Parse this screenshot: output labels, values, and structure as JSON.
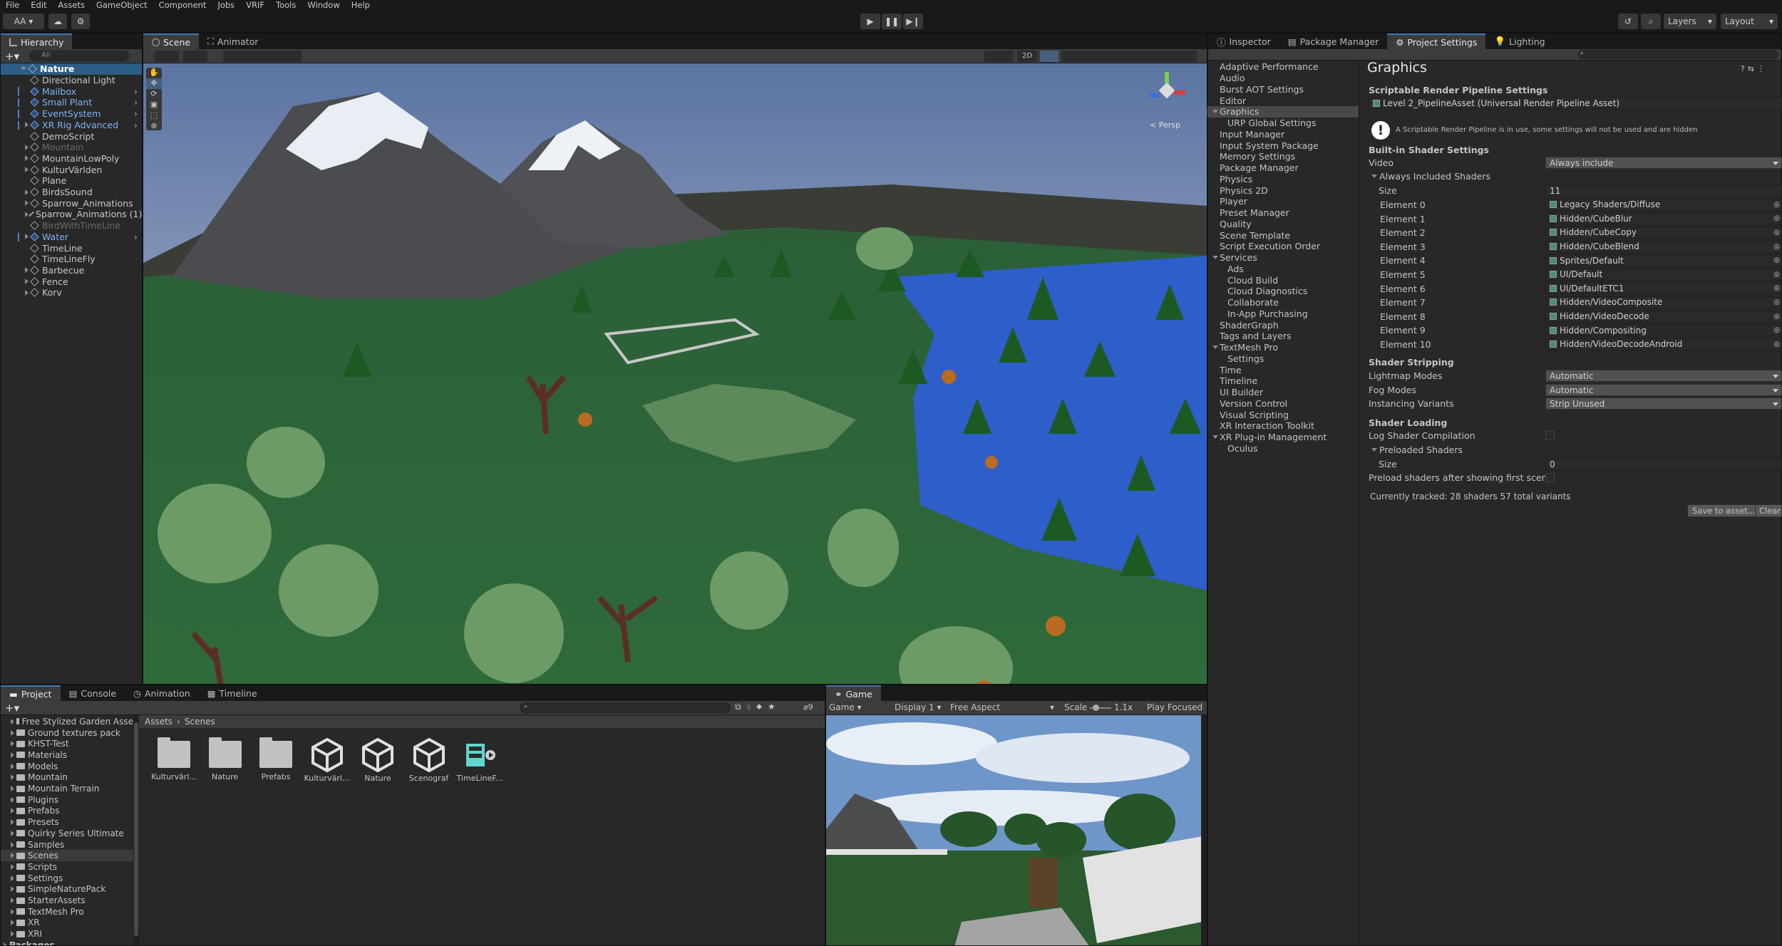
{
  "menu": [
    "File",
    "Edit",
    "Assets",
    "GameObject",
    "Component",
    "Jobs",
    "VRIF",
    "Tools",
    "Window",
    "Help"
  ],
  "toolbar": {
    "account": "AA",
    "layers": "Layers",
    "layout": "Layout"
  },
  "hierarchy": {
    "tab": "Hierarchy",
    "search_placeholder": "All",
    "scene": "Nature",
    "items": [
      {
        "label": "Directional Light",
        "blue": false,
        "expand": false,
        "dim": false
      },
      {
        "label": "Mailbox",
        "blue": true,
        "expand": false,
        "dim": false
      },
      {
        "label": "Small Plant",
        "blue": true,
        "expand": false,
        "dim": false
      },
      {
        "label": "EventSystem",
        "blue": true,
        "expand": false,
        "dim": false
      },
      {
        "label": "XR Rig Advanced",
        "blue": true,
        "expand": true,
        "dim": false
      },
      {
        "label": "DemoScript",
        "blue": false,
        "expand": false,
        "dim": false
      },
      {
        "label": "Mountain",
        "blue": false,
        "expand": true,
        "dim": true
      },
      {
        "label": "MountainLowPoly",
        "blue": false,
        "expand": true,
        "dim": false
      },
      {
        "label": "KulturVärlden",
        "blue": false,
        "expand": true,
        "dim": false
      },
      {
        "label": "Plane",
        "blue": false,
        "expand": false,
        "dim": false
      },
      {
        "label": "BirdsSound",
        "blue": false,
        "expand": true,
        "dim": false
      },
      {
        "label": "Sparrow_Animations",
        "blue": false,
        "expand": true,
        "dim": false
      },
      {
        "label": "Sparrow_Animations (1)",
        "blue": false,
        "expand": true,
        "dim": false
      },
      {
        "label": "BirdWithTimeLine",
        "blue": false,
        "expand": false,
        "dim": true
      },
      {
        "label": "Water",
        "blue": true,
        "expand": true,
        "dim": false
      },
      {
        "label": "TimeLine",
        "blue": false,
        "expand": false,
        "dim": false
      },
      {
        "label": "TimeLineFly",
        "blue": false,
        "expand": false,
        "dim": false
      },
      {
        "label": "Barbecue",
        "blue": false,
        "expand": true,
        "dim": false
      },
      {
        "label": "Fence",
        "blue": false,
        "expand": true,
        "dim": false
      },
      {
        "label": "Korv",
        "blue": false,
        "expand": true,
        "dim": false
      }
    ]
  },
  "scene": {
    "tabs": [
      "Scene",
      "Animator"
    ],
    "mode_2d": "2D",
    "persp": "Persp"
  },
  "inspector": {
    "tabs": [
      "Inspector",
      "Package Manager",
      "Project Settings",
      "Lighting"
    ]
  },
  "settings_list": [
    {
      "label": "Adaptive Performance",
      "indent": 0,
      "exp": ""
    },
    {
      "label": "Audio",
      "indent": 0,
      "exp": ""
    },
    {
      "label": "Burst AOT Settings",
      "indent": 0,
      "exp": ""
    },
    {
      "label": "Editor",
      "indent": 0,
      "exp": ""
    },
    {
      "label": "Graphics",
      "indent": 0,
      "exp": "down",
      "selected": true
    },
    {
      "label": "URP Global Settings",
      "indent": 1,
      "exp": ""
    },
    {
      "label": "Input Manager",
      "indent": 0,
      "exp": ""
    },
    {
      "label": "Input System Package",
      "indent": 0,
      "exp": ""
    },
    {
      "label": "Memory Settings",
      "indent": 0,
      "exp": ""
    },
    {
      "label": "Package Manager",
      "indent": 0,
      "exp": ""
    },
    {
      "label": "Physics",
      "indent": 0,
      "exp": ""
    },
    {
      "label": "Physics 2D",
      "indent": 0,
      "exp": ""
    },
    {
      "label": "Player",
      "indent": 0,
      "exp": ""
    },
    {
      "label": "Preset Manager",
      "indent": 0,
      "exp": ""
    },
    {
      "label": "Quality",
      "indent": 0,
      "exp": ""
    },
    {
      "label": "Scene Template",
      "indent": 0,
      "exp": ""
    },
    {
      "label": "Script Execution Order",
      "indent": 0,
      "exp": ""
    },
    {
      "label": "Services",
      "indent": 0,
      "exp": "down"
    },
    {
      "label": "Ads",
      "indent": 1,
      "exp": ""
    },
    {
      "label": "Cloud Build",
      "indent": 1,
      "exp": ""
    },
    {
      "label": "Cloud Diagnostics",
      "indent": 1,
      "exp": ""
    },
    {
      "label": "Collaborate",
      "indent": 1,
      "exp": ""
    },
    {
      "label": "In-App Purchasing",
      "indent": 1,
      "exp": ""
    },
    {
      "label": "ShaderGraph",
      "indent": 0,
      "exp": ""
    },
    {
      "label": "Tags and Layers",
      "indent": 0,
      "exp": ""
    },
    {
      "label": "TextMesh Pro",
      "indent": 0,
      "exp": "down"
    },
    {
      "label": "Settings",
      "indent": 1,
      "exp": ""
    },
    {
      "label": "Time",
      "indent": 0,
      "exp": ""
    },
    {
      "label": "Timeline",
      "indent": 0,
      "exp": ""
    },
    {
      "label": "UI Builder",
      "indent": 0,
      "exp": ""
    },
    {
      "label": "Version Control",
      "indent": 0,
      "exp": ""
    },
    {
      "label": "Visual Scripting",
      "indent": 0,
      "exp": ""
    },
    {
      "label": "XR Interaction Toolkit",
      "indent": 0,
      "exp": ""
    },
    {
      "label": "XR Plug-in Management",
      "indent": 0,
      "exp": "down"
    },
    {
      "label": "Oculus",
      "indent": 1,
      "exp": ""
    }
  ],
  "graphics": {
    "title": "Graphics",
    "srp_header": "Scriptable Render Pipeline Settings",
    "srp_asset": "Level 2_PipelineAsset (Universal Render Pipeline Asset)",
    "warning": "A Scriptable Render Pipeline is in use, some settings will not be used and are hidden",
    "builtin_header": "Built-in Shader Settings",
    "video_label": "Video",
    "video_value": "Always include",
    "always_included": "Always Included Shaders",
    "size_label": "Size",
    "size_value": "11",
    "elements": [
      {
        "label": "Element 0",
        "value": "Legacy Shaders/Diffuse"
      },
      {
        "label": "Element 1",
        "value": "Hidden/CubeBlur"
      },
      {
        "label": "Element 2",
        "value": "Hidden/CubeCopy"
      },
      {
        "label": "Element 3",
        "value": "Hidden/CubeBlend"
      },
      {
        "label": "Element 4",
        "value": "Sprites/Default"
      },
      {
        "label": "Element 5",
        "value": "UI/Default"
      },
      {
        "label": "Element 6",
        "value": "UI/DefaultETC1"
      },
      {
        "label": "Element 7",
        "value": "Hidden/VideoComposite"
      },
      {
        "label": "Element 8",
        "value": "Hidden/VideoDecode"
      },
      {
        "label": "Element 9",
        "value": "Hidden/Compositing"
      },
      {
        "label": "Element 10",
        "value": "Hidden/VideoDecodeAndroid"
      }
    ],
    "stripping_header": "Shader Stripping",
    "lightmap_label": "Lightmap Modes",
    "lightmap_value": "Automatic",
    "fog_label": "Fog Modes",
    "fog_value": "Automatic",
    "instancing_label": "Instancing Variants",
    "instancing_value": "Strip Unused",
    "loading_header": "Shader Loading",
    "log_label": "Log Shader Compilation",
    "preloaded_label": "Preloaded Shaders",
    "pre_size_label": "Size",
    "pre_size_value": "0",
    "preload_label": "Preload shaders after showing first scene",
    "tracked": "Currently tracked: 28 shaders 57 total variants",
    "save_btn": "Save to asset...",
    "clear_btn": "Clear"
  },
  "project": {
    "tabs": [
      "Project",
      "Console",
      "Animation",
      "Timeline"
    ],
    "hidden_count": "9",
    "folders": [
      "Free Stylized Garden Asse",
      "Ground textures pack",
      "KHST-Test",
      "Materials",
      "Models",
      "Mountain",
      "Mountain Terrain",
      "Plugins",
      "Prefabs",
      "Presets",
      "Quirky Series Ultimate",
      "Samples",
      "Scenes",
      "Scripts",
      "Settings",
      "SimpleNaturePack",
      "StarterAssets",
      "TextMesh Pro",
      "XR",
      "XRI"
    ],
    "packages": "Packages",
    "breadcrumb": [
      "Assets",
      "Scenes"
    ],
    "assets": [
      {
        "label": "Kulturvärl...",
        "kind": "folder"
      },
      {
        "label": "Nature",
        "kind": "folder"
      },
      {
        "label": "Prefabs",
        "kind": "folder"
      },
      {
        "label": "Kulturvärl...",
        "kind": "unity"
      },
      {
        "label": "Nature",
        "kind": "unity"
      },
      {
        "label": "Scenograf",
        "kind": "unity"
      },
      {
        "label": "TimeLineF...",
        "kind": "timeline"
      }
    ]
  },
  "game": {
    "tab": "Game",
    "mode": "Game",
    "display": "Display 1",
    "aspect": "Free Aspect",
    "scale_label": "Scale",
    "scale_value": "1.1x",
    "play_focused": "Play Focused"
  }
}
